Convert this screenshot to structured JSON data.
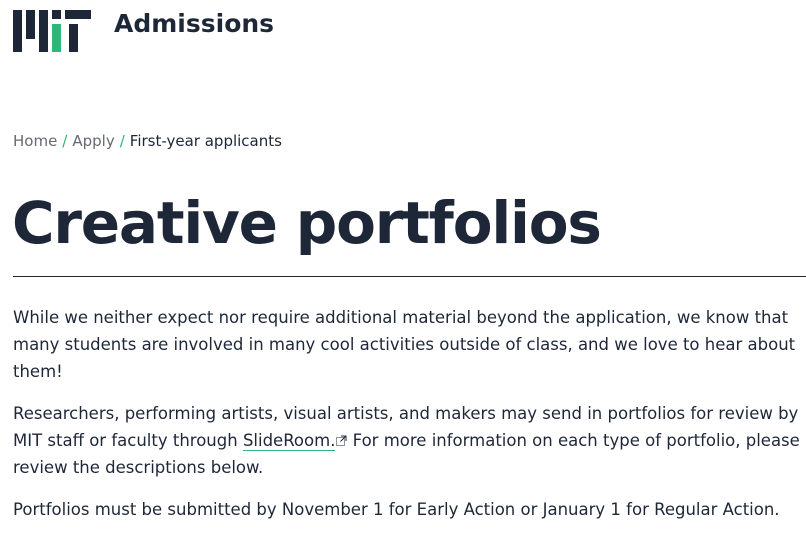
{
  "header": {
    "logo_icon": "mit-logo-icon",
    "site_title": "Admissions",
    "accent_color": "#2fb77a",
    "text_color": "#1e2738"
  },
  "breadcrumb": {
    "items": [
      {
        "label": "Home"
      },
      {
        "label": "Apply"
      }
    ],
    "separator": "/",
    "current": "First-year applicants"
  },
  "main": {
    "title": "Creative portfolios",
    "paragraphs": {
      "p1": "While we neither expect nor require additional material beyond the application, we know that many students are involved in many cool activities outside of class, and we love to hear about them!",
      "p2_before": "Researchers, performing artists, visual artists, and makers may send in portfolios for review by MIT staff or faculty through ",
      "p2_link": "SlideRoom.",
      "p2_link_icon": "external-link-icon",
      "p2_after": " For more information on each type of portfolio, please review the descriptions below.",
      "p3": "Portfolios must be submitted by November 1 for Early Action or January 1 for Regular Action."
    }
  }
}
